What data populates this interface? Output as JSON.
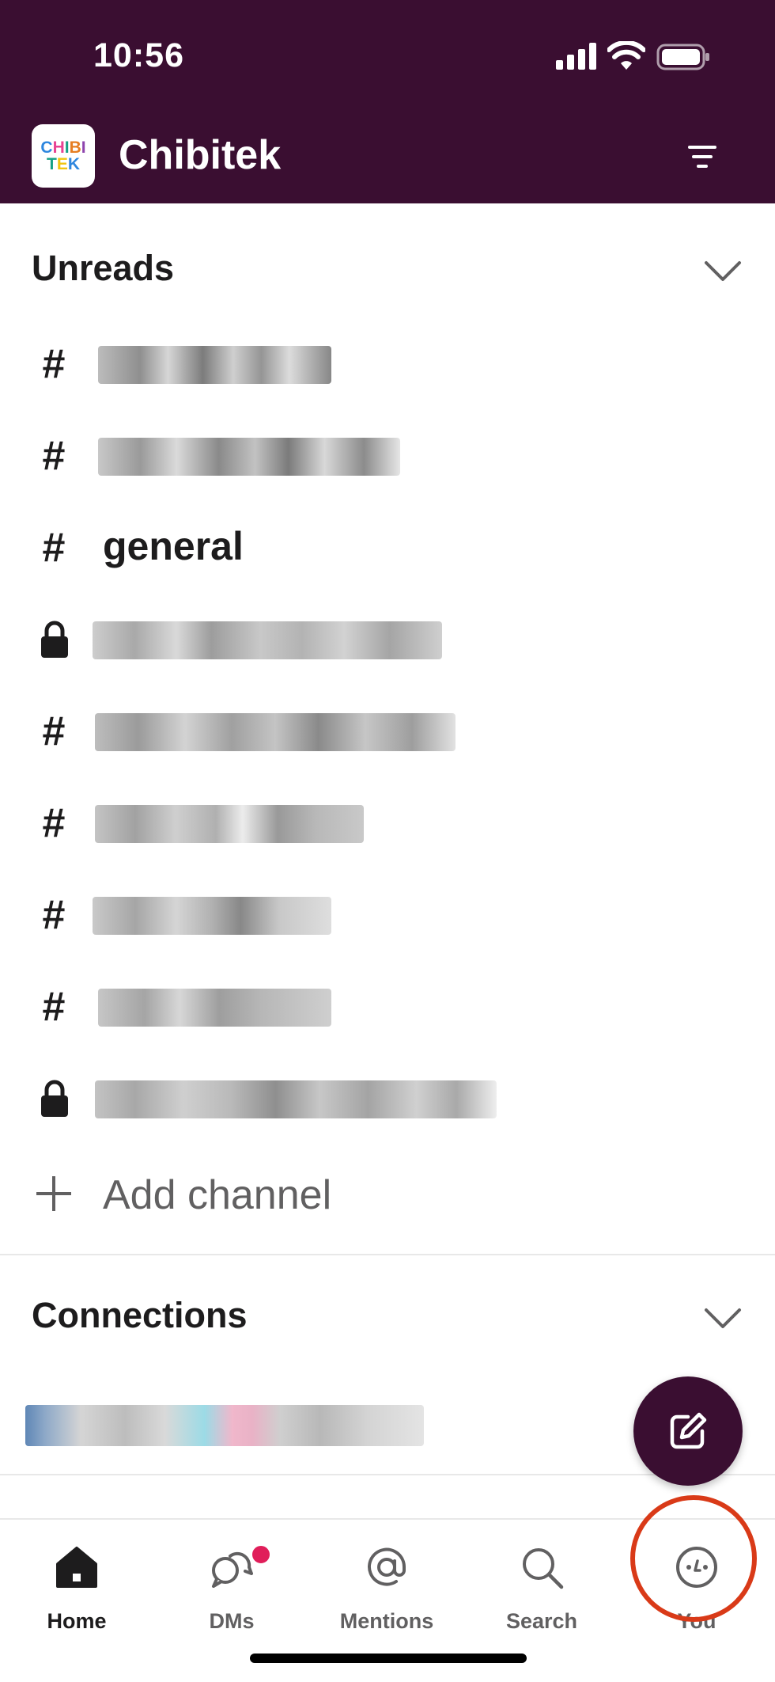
{
  "status_bar": {
    "time": "10:56"
  },
  "workspace": {
    "name": "Chibitek",
    "logo_line1": "CHIBI",
    "logo_line2": "TEK"
  },
  "unreads": {
    "title": "Unreads",
    "channels": [
      {
        "type": "public",
        "label": ""
      },
      {
        "type": "public",
        "label": ""
      },
      {
        "type": "public",
        "label": "general"
      },
      {
        "type": "private",
        "label": ""
      },
      {
        "type": "public",
        "label": ""
      },
      {
        "type": "public",
        "label": ""
      },
      {
        "type": "public",
        "label": ""
      },
      {
        "type": "public",
        "label": ""
      },
      {
        "type": "private",
        "label": ""
      }
    ],
    "add_channel_label": "Add channel"
  },
  "connections": {
    "title": "Connections"
  },
  "tabs": [
    {
      "label": "Home",
      "icon": "home-icon",
      "active": true
    },
    {
      "label": "DMs",
      "icon": "dms-icon",
      "active": false,
      "badge": true
    },
    {
      "label": "Mentions",
      "icon": "at-icon",
      "active": false
    },
    {
      "label": "Search",
      "icon": "search-icon",
      "active": false
    },
    {
      "label": "You",
      "icon": "you-icon",
      "active": false
    }
  ],
  "colors": {
    "header_bg": "#3a0e31",
    "badge": "#e01e5a",
    "highlight_ring": "#d93a18"
  },
  "icons": {
    "hash": "#",
    "compose": "compose-icon",
    "filter": "filter-icon",
    "lock": "lock-icon"
  }
}
